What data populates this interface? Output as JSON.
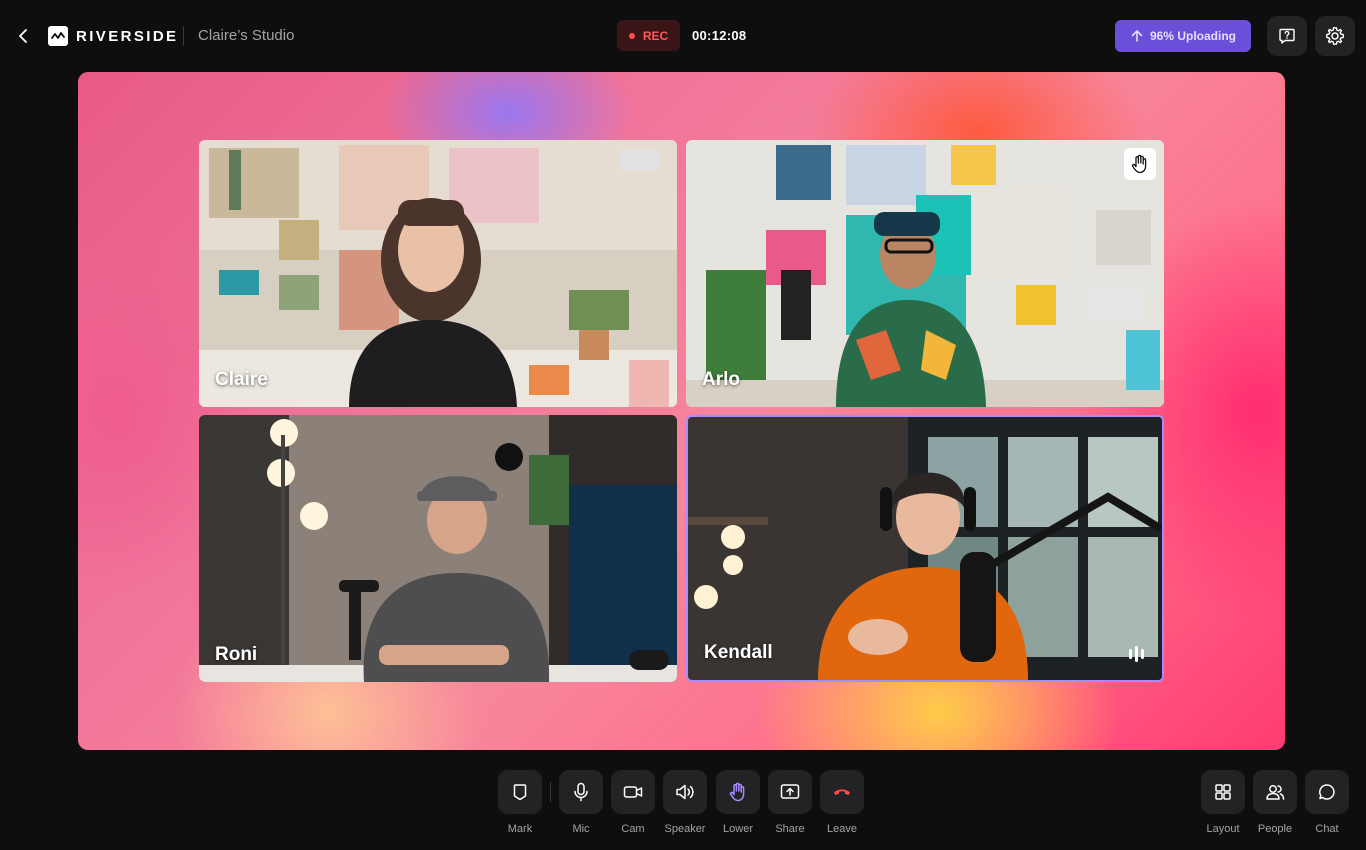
{
  "header": {
    "brand": "RIVERSIDE",
    "studio_name": "Claire’s Studio",
    "rec_label": "REC",
    "timer": "00:12:08",
    "upload_label": "96% Uploading"
  },
  "participants": [
    {
      "name": "Claire",
      "hand_raised": false,
      "speaking": false
    },
    {
      "name": "Arlo",
      "hand_raised": true,
      "speaking": false
    },
    {
      "name": "Roni",
      "hand_raised": false,
      "speaking": false
    },
    {
      "name": "Kendall",
      "hand_raised": false,
      "speaking": true
    }
  ],
  "controls": {
    "mark": "Mark",
    "mic": "Mic",
    "cam": "Cam",
    "speaker": "Speaker",
    "lower": "Lower",
    "share": "Share",
    "leave": "Leave",
    "layout": "Layout",
    "people": "People",
    "chat": "Chat"
  },
  "colors": {
    "background": "#0e0e0f",
    "rec_text": "#ff5a5a",
    "upload_bg": "#6b4fd9",
    "leave_icon": "#ff4d4d",
    "hand_icon": "#a88bff",
    "active_tile_border": "#a88bff"
  },
  "icons": {
    "back": "chevron-left-icon",
    "help": "help-chat-icon",
    "settings": "gear-icon",
    "upload": "arrow-up-icon",
    "hand": "raised-hand-icon",
    "speaking": "audio-level-icon"
  }
}
